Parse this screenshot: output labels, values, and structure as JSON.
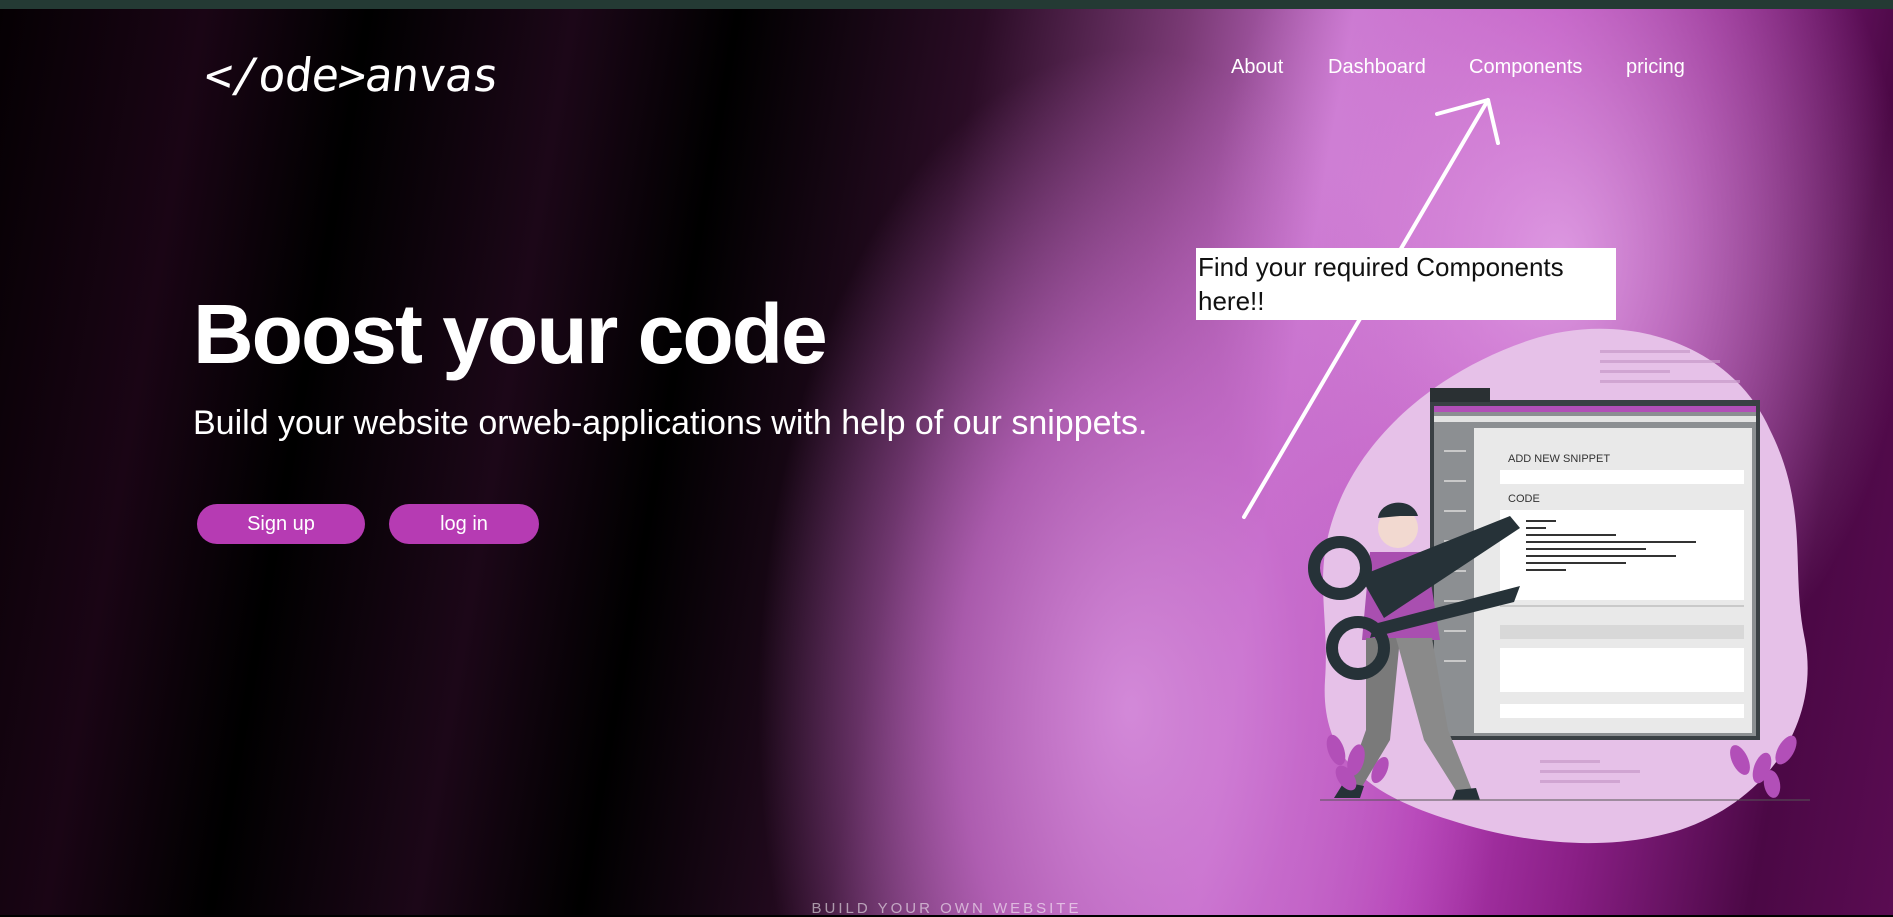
{
  "brand": {
    "logo_text": "</ode>anvas"
  },
  "nav": {
    "items": [
      {
        "label": "About"
      },
      {
        "label": "Dashboard"
      },
      {
        "label": "Components"
      },
      {
        "label": "pricing"
      }
    ]
  },
  "hero": {
    "headline": "Boost your code",
    "subheadline": "Build your website orweb-applications with help of our snippets.",
    "signup_label": "Sign up",
    "login_label": "log in"
  },
  "callout": {
    "text": "Find your required Components here!!"
  },
  "illustration": {
    "form_title": "ADD NEW SNIPPET",
    "code_label": "CODE"
  },
  "footer": {
    "label": "BUILD YOUR OWN WEBSITE"
  },
  "colors": {
    "accent": "#b63bb3",
    "topstrip": "#243a34"
  }
}
